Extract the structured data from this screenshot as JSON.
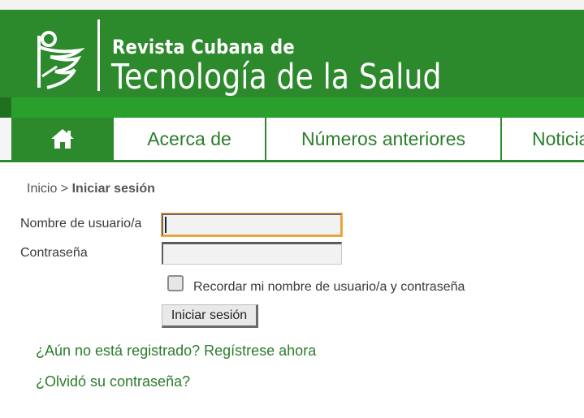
{
  "header": {
    "journal_line1": "Revista Cubana de",
    "journal_line2": "Tecnología de la Salud",
    "logo_icon": "journal-logo-icon",
    "colors": {
      "banner": "#2c8a2c",
      "nav_bar": "#29a02b",
      "link": "#2b7d2b"
    }
  },
  "nav": {
    "home_icon": "home-icon",
    "items": [
      {
        "label": "Acerca de"
      },
      {
        "label": "Números anteriores"
      },
      {
        "label": "Noticias"
      }
    ]
  },
  "breadcrumb": {
    "home": "Inicio",
    "separator": " > ",
    "current": "Iniciar sesión"
  },
  "login": {
    "username_label": "Nombre de usuario/a",
    "username_value": "",
    "password_label": "Contraseña",
    "password_value": "",
    "remember_label": "Recordar mi nombre de usuario/a y contraseña",
    "remember_checked": false,
    "submit_label": "Iniciar sesión"
  },
  "links": {
    "register": "¿Aún no está registrado? Regístrese ahora",
    "forgot": "¿Olvidó su contraseña?"
  }
}
